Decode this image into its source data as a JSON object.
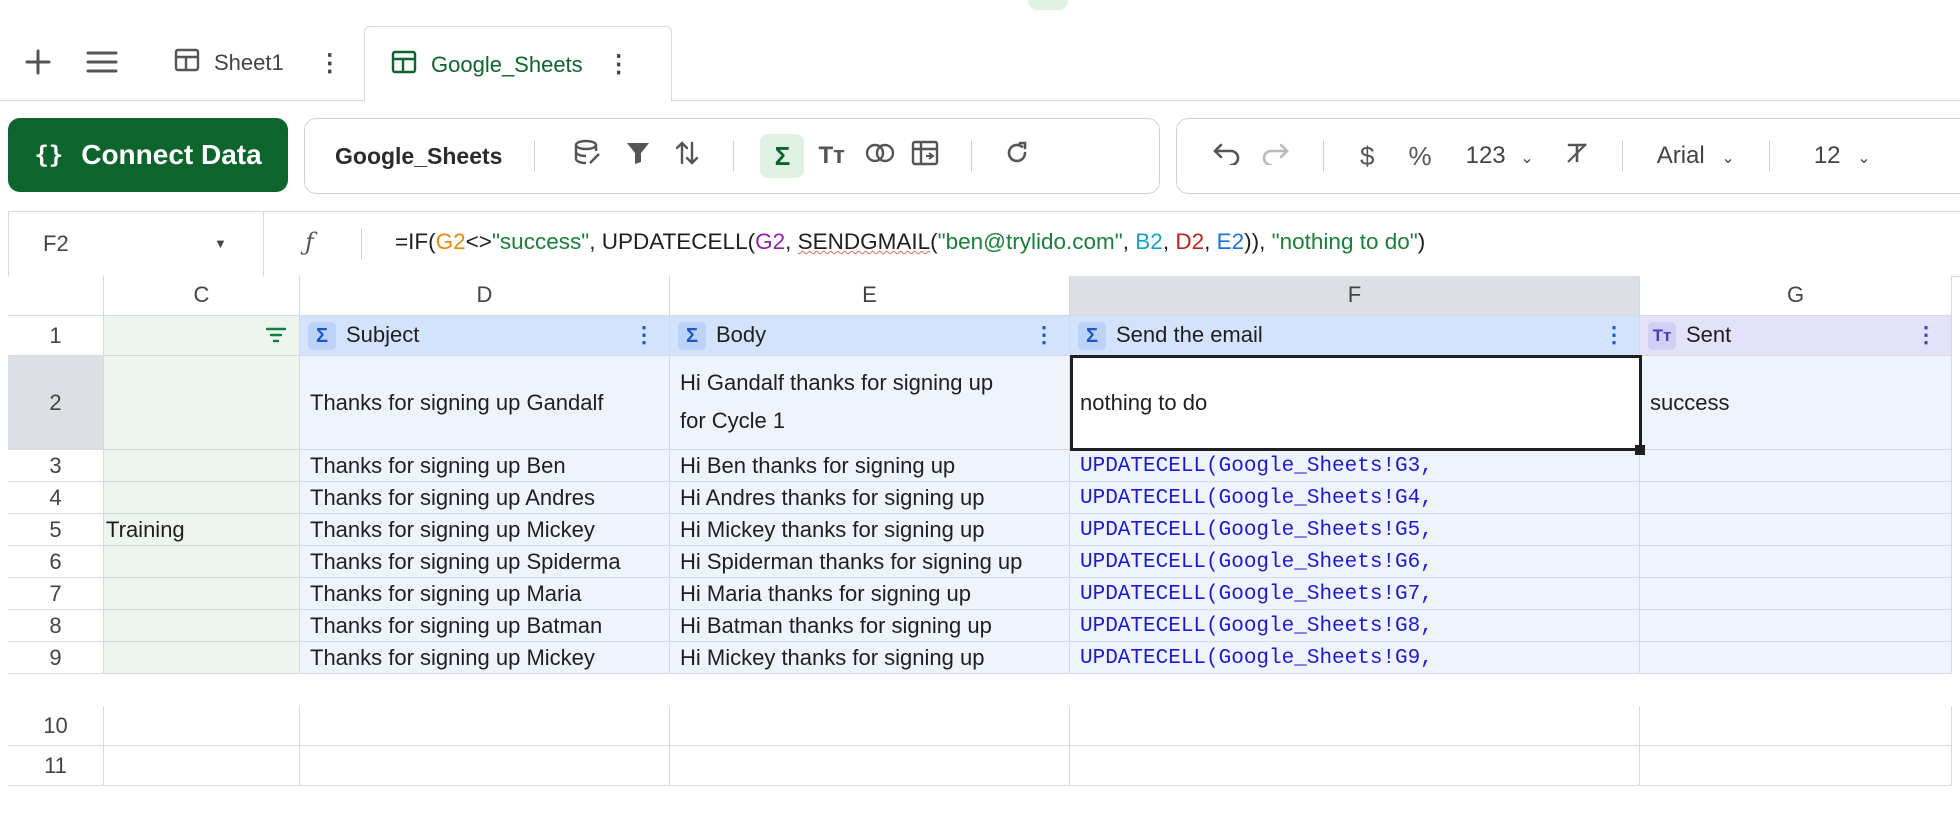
{
  "tabs": [
    {
      "label": "Sheet1"
    },
    {
      "label": "Google_Sheets"
    }
  ],
  "toolbar": {
    "connect_label": "Connect Data",
    "sheet_name": "Google_Sheets",
    "number_format": "123",
    "font": "Arial",
    "font_size": "12",
    "currency_symbol": "$",
    "percent_symbol": "%"
  },
  "formula_bar": {
    "cell_ref": "F2",
    "fx": "ƒ",
    "parts": [
      "=IF(",
      "G2",
      "<>",
      "\"success\"",
      ", UPDATECELL(",
      "G2",
      ", ",
      "SENDGMAIL",
      "(",
      "\"ben@trylido.com\"",
      ", ",
      "B2",
      ", ",
      "D2",
      ", ",
      "E2",
      ")), ",
      "\"nothing to do\"",
      ")"
    ]
  },
  "columns": [
    "C",
    "D",
    "E",
    "F",
    "G"
  ],
  "header_row": {
    "row_number": "1",
    "D": "Subject",
    "E": "Body",
    "F": "Send the email",
    "G": "Sent"
  },
  "rows": [
    {
      "n": "2",
      "C": "",
      "D": "Thanks for signing up Gandalf",
      "E1": "Hi Gandalf thanks for signing up",
      "E2": "for Cycle 1",
      "F": "nothing to do",
      "G": "success"
    },
    {
      "n": "3",
      "C": "",
      "D": "Thanks for signing up Ben",
      "E": "Hi Ben thanks for signing up",
      "F": "UPDATECELL(Google_Sheets!G3,",
      "G": ""
    },
    {
      "n": "4",
      "C": "",
      "D": "Thanks for signing up Andres",
      "E": "Hi Andres thanks for signing up",
      "F": "UPDATECELL(Google_Sheets!G4,",
      "G": ""
    },
    {
      "n": "5",
      "C": "Training",
      "D": "Thanks for signing up Mickey",
      "E": "Hi Mickey thanks for signing up",
      "F": "UPDATECELL(Google_Sheets!G5,",
      "G": ""
    },
    {
      "n": "6",
      "C": "",
      "D": "Thanks for signing up Spiderma",
      "E": "Hi Spiderman thanks for signing up",
      "F": "UPDATECELL(Google_Sheets!G6,",
      "G": ""
    },
    {
      "n": "7",
      "C": "",
      "D": "Thanks for signing up Maria",
      "E": "Hi Maria thanks for signing up",
      "F": "UPDATECELL(Google_Sheets!G7,",
      "G": ""
    },
    {
      "n": "8",
      "C": "",
      "D": "Thanks for signing up Batman",
      "E": "Hi Batman thanks for signing up",
      "F": "UPDATECELL(Google_Sheets!G8,",
      "G": ""
    },
    {
      "n": "9",
      "C": "",
      "D": "Thanks for signing up Mickey",
      "E": "Hi Mickey thanks for signing up",
      "F": "UPDATECELL(Google_Sheets!G9,",
      "G": ""
    }
  ],
  "empty_rows": [
    "10",
    "11"
  ]
}
